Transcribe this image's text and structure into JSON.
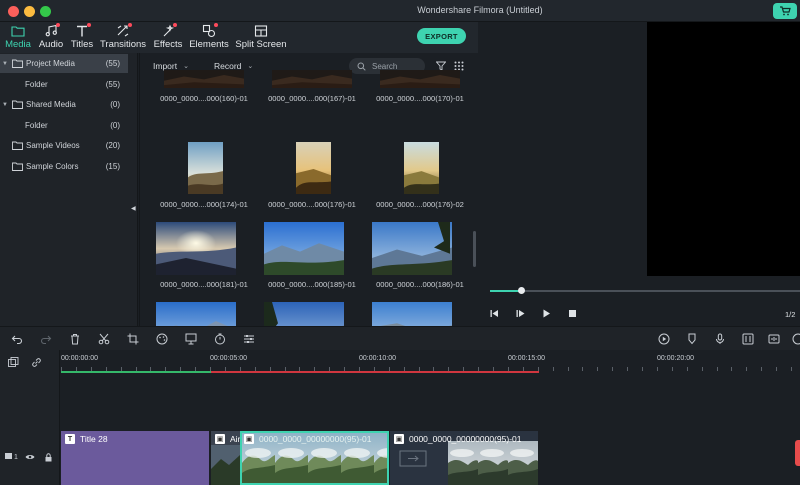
{
  "window": {
    "title": "Wondershare Filmora (Untitled)"
  },
  "tabs": [
    {
      "label": "Media",
      "icon": "folder-icon",
      "active": true,
      "dot": false
    },
    {
      "label": "Audio",
      "icon": "music-note-icon",
      "active": false,
      "dot": true
    },
    {
      "label": "Titles",
      "icon": "text-t-icon",
      "active": false,
      "dot": true
    },
    {
      "label": "Transitions",
      "icon": "transition-icon",
      "active": false,
      "dot": true
    },
    {
      "label": "Effects",
      "icon": "effects-sparkle-icon",
      "active": false,
      "dot": true
    },
    {
      "label": "Elements",
      "icon": "elements-icon",
      "active": false,
      "dot": true
    },
    {
      "label": "Split Screen",
      "icon": "split-screen-icon",
      "active": false,
      "dot": false
    }
  ],
  "export_label": "EXPORT",
  "tree": [
    {
      "label": "Project Media",
      "count": "(55)",
      "expandable": true,
      "selected": true,
      "indent": 0
    },
    {
      "label": "Folder",
      "count": "(55)",
      "expandable": false,
      "selected": false,
      "indent": 1
    },
    {
      "label": "Shared Media",
      "count": "(0)",
      "expandable": true,
      "selected": false,
      "indent": 0
    },
    {
      "label": "Folder",
      "count": "(0)",
      "expandable": false,
      "selected": false,
      "indent": 1
    },
    {
      "label": "Sample Videos",
      "count": "(20)",
      "expandable": false,
      "selected": false,
      "indent": 0
    },
    {
      "label": "Sample Colors",
      "count": "(15)",
      "expandable": false,
      "selected": false,
      "indent": 0
    }
  ],
  "media_toolbar": {
    "import_label": "Import",
    "record_label": "Record",
    "search_placeholder": "Search"
  },
  "media_items": [
    {
      "caption": "0000_0000....000(160)-01",
      "scene": "dark-peak"
    },
    {
      "caption": "0000_0000....000(167)-01",
      "scene": "dark-peak"
    },
    {
      "caption": "0000_0000....000(170)-01",
      "scene": "dark-peak"
    },
    {
      "caption": "0000_0000....000(174)-01",
      "scene": "portrait-sunrise"
    },
    {
      "caption": "0000_0000....000(176)-01",
      "scene": "portrait-golden"
    },
    {
      "caption": "0000_0000....000(176)-02",
      "scene": "portrait-golden-2"
    },
    {
      "caption": "0000_0000....000(181)-01",
      "scene": "sunset-valley"
    },
    {
      "caption": "0000_0000....000(185)-01",
      "scene": "blue-mountains"
    },
    {
      "caption": "0000_0000....000(186)-01",
      "scene": "tree-mountains"
    },
    {
      "caption": "",
      "scene": "blue-ridge"
    },
    {
      "caption": "",
      "scene": "pine-mountains"
    },
    {
      "caption": "",
      "scene": "green-slope"
    }
  ],
  "preview": {
    "progress": 0.1,
    "page_indicator": "1/2"
  },
  "timeline": {
    "ruler_labels": [
      "00:00:00:00",
      "00:00:05:00",
      "00:00:10:00",
      "00:00:15:00",
      "00:00:20:00"
    ],
    "clips": [
      {
        "label": "Title 28",
        "kind": "title"
      },
      {
        "label": "Air",
        "kind": "video"
      },
      {
        "label": "0000_0000_00000000(95)-01",
        "kind": "video-selected"
      },
      {
        "label": "0000_0000_00000000(95)-01",
        "kind": "video"
      }
    ],
    "track_number": "1"
  }
}
